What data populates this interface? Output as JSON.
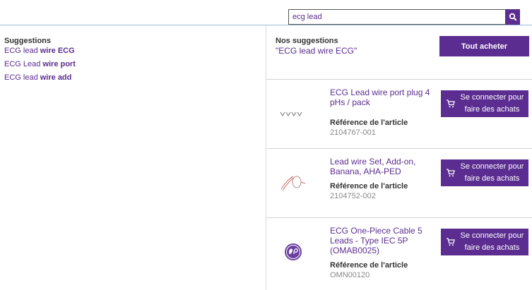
{
  "search": {
    "value": "ecg lead",
    "button_icon": "search-icon"
  },
  "left": {
    "title": "Suggestions",
    "items": [
      {
        "prefix": "ECG lead ",
        "bold": "wire ECG"
      },
      {
        "prefix": "ECG Lead ",
        "bold": "wire port"
      },
      {
        "prefix": "ECG lead ",
        "bold": "wire add"
      }
    ]
  },
  "right": {
    "title": "Nos suggestions",
    "query": "\"ECG lead wire ECG\"",
    "buy_all_label": "Tout acheter",
    "ref_label": "Référence de l'article",
    "login_label": "Se connecter pour faire des achats",
    "products": [
      {
        "name": "ECG Lead wire port plug 4 pHs / pack",
        "ref": "2104767-001",
        "image": "lead-wire-plug-image"
      },
      {
        "name": "Lead wire Set, Add-on, Banana, AHA-PED",
        "ref": "2104752-002",
        "image": "lead-wire-set-image"
      },
      {
        "name": "ECG One-Piece Cable 5 Leads - Type IEC 5P (OMAB0025)",
        "ref": "OMN00120",
        "image": "ge-logo-image"
      }
    ]
  },
  "colors": {
    "accent": "#5b2d90",
    "border": "#d4d4d4",
    "link": "#5b2d90"
  }
}
